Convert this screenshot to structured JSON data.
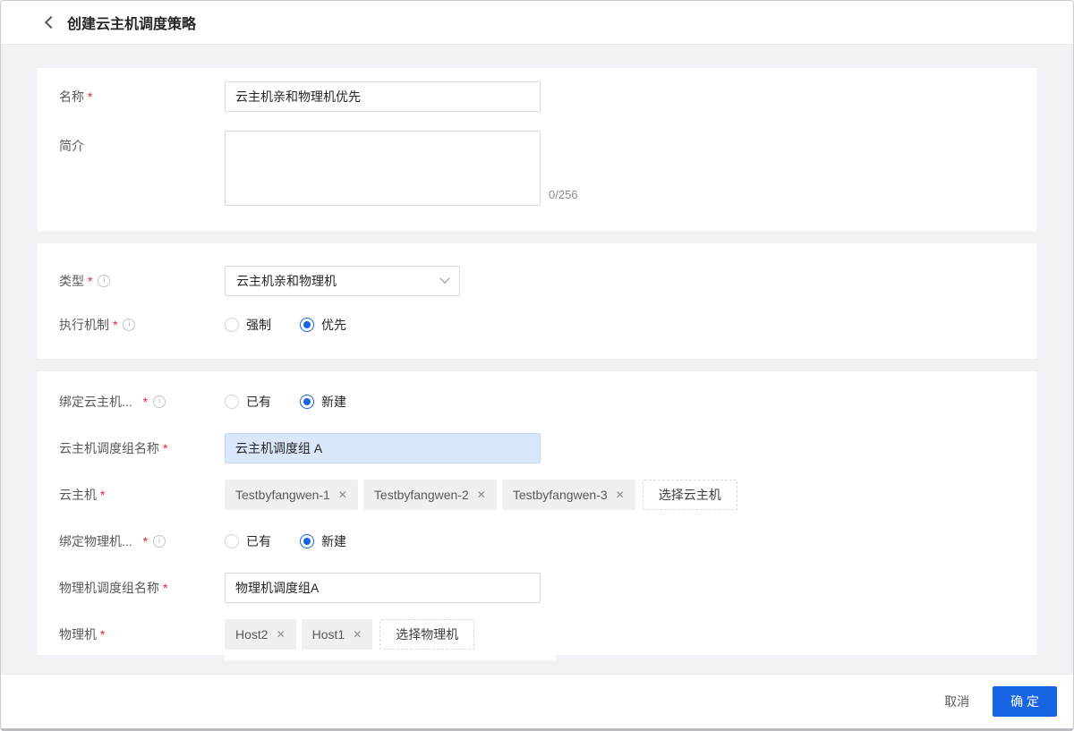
{
  "header": {
    "title": "创建云主机调度策略"
  },
  "basic": {
    "name_label": "名称",
    "name_value": "云主机亲和物理机优先",
    "desc_label": "简介",
    "desc_counter": "0/256"
  },
  "type": {
    "type_label": "类型",
    "type_value": "云主机亲和物理机",
    "mechanism_label": "执行机制",
    "mechanism_options": [
      {
        "label": "强制",
        "selected": false
      },
      {
        "label": "优先",
        "selected": true
      }
    ]
  },
  "binding": {
    "vm_bind": {
      "label": "绑定云主机...",
      "existing": "已有",
      "new": "新建"
    },
    "vm_group_name": {
      "label": "云主机调度组名称",
      "value": "云主机调度组 A"
    },
    "vms": {
      "label": "云主机",
      "tags": [
        "Testbyfangwen-1",
        "Testbyfangwen-2",
        "Testbyfangwen-3"
      ],
      "button": "选择云主机"
    },
    "host_bind": {
      "label": "绑定物理机...",
      "existing": "已有",
      "new": "新建"
    },
    "host_group_name": {
      "label": "物理机调度组名称",
      "value": "物理机调度组A"
    },
    "hosts": {
      "label": "物理机",
      "tags": [
        "Host2",
        "Host1"
      ],
      "button": "选择物理机"
    }
  },
  "footer": {
    "cancel": "取消",
    "confirm": "确 定"
  },
  "misc": {
    "required_mark": "*",
    "close_icon": "✕",
    "info_glyph": "i"
  },
  "colors": {
    "primary": "#1765e5",
    "selected_input_bg": "#d9e7fb",
    "page_bg": "#f0f2f6"
  }
}
